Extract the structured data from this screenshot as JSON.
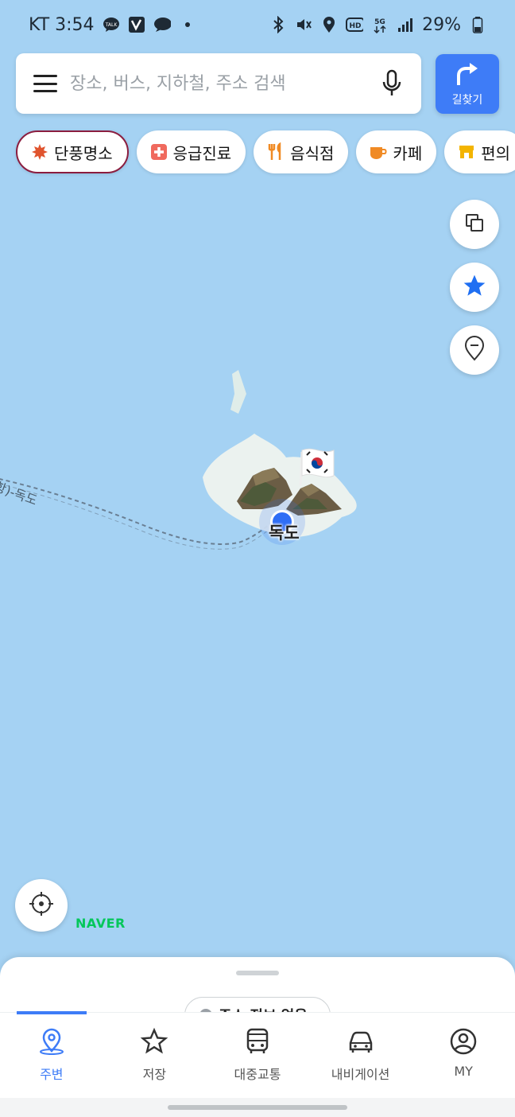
{
  "status_bar": {
    "carrier_time": "KT 3:54",
    "left_icons": [
      "talk-icon",
      "v-app-icon",
      "chat-bubble-icon",
      "dot-icon"
    ],
    "right_icons": [
      "bluetooth-icon",
      "mute-icon",
      "location-icon",
      "hd-icon",
      "5g-icon",
      "signal-icon"
    ],
    "battery": "29%"
  },
  "search": {
    "placeholder": "장소, 버스, 지하철, 주소 검색",
    "route_button_label": "길찾기"
  },
  "chips": [
    {
      "label": "단풍명소",
      "icon": "maple-leaf-icon",
      "active": true
    },
    {
      "label": "응급진료",
      "icon": "medical-cross-icon",
      "active": false
    },
    {
      "label": "음식점",
      "icon": "fork-knife-icon",
      "active": false
    },
    {
      "label": "카페",
      "icon": "coffee-cup-icon",
      "active": false
    },
    {
      "label": "편의",
      "icon": "store-icon",
      "active": false
    }
  ],
  "map": {
    "place_label": "독도",
    "route_label": "항)-독도",
    "logo": "NAVER",
    "water_color": "#a5d2f3"
  },
  "fabs": [
    "layers-icon",
    "favorites-star-icon",
    "place-pin-icon"
  ],
  "sheet": {
    "address_pill": "주소 정보 없음"
  },
  "tabs": [
    {
      "label": "주변",
      "icon": "around-pin-icon",
      "active": true
    },
    {
      "label": "저장",
      "icon": "star-outline-icon",
      "active": false
    },
    {
      "label": "대중교통",
      "icon": "bus-icon",
      "active": false
    },
    {
      "label": "내비게이션",
      "icon": "car-icon",
      "active": false
    },
    {
      "label": "MY",
      "icon": "profile-icon",
      "active": false
    }
  ],
  "colors": {
    "accent": "#3e7cf7",
    "naver_green": "#03c75a",
    "chip_active_border": "#8b1d3f"
  }
}
